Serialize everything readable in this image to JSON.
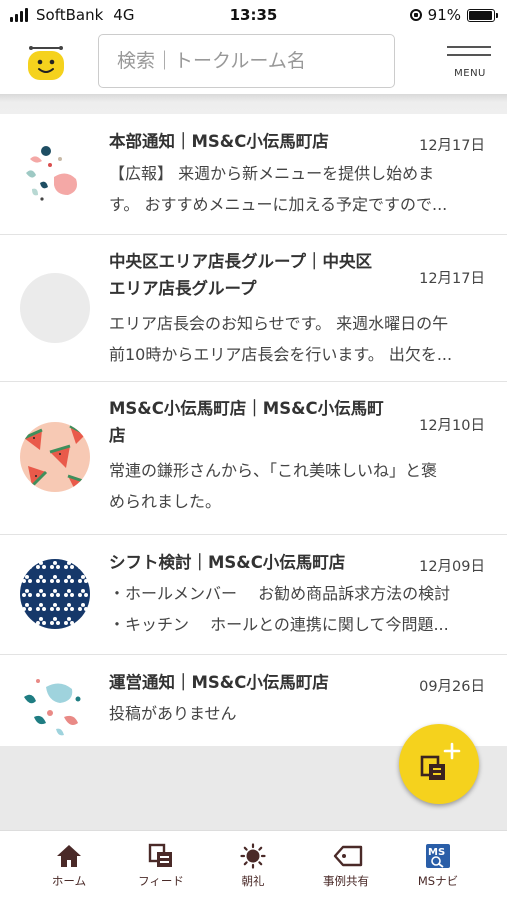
{
  "status_bar": {
    "carrier": "SoftBank",
    "network": "4G",
    "time": "13:35",
    "battery": "91%",
    "battery_level": 0.91
  },
  "header": {
    "search_placeholder": "検索｜トークルーム名",
    "menu_label": "MENU"
  },
  "rooms": [
    {
      "title": "本部通知｜MS&C小伝馬町店",
      "date": "12月17日",
      "preview_lines": [
        "【広報】 来週から新メニューを提供し始めま",
        "す。 おすすめメニューに加える予定ですので..."
      ],
      "avatar_icon": "confetti-pattern-icon"
    },
    {
      "title_lines": [
        "中央区エリア店長グループ｜中央区",
        "エリア店長グループ"
      ],
      "date": "12月17日",
      "preview_lines": [
        "エリア店長会のお知らせです。 来週水曜日の午",
        "前10時からエリア店長会を行います。 出欠を..."
      ],
      "avatar_icon": "blank-avatar-icon"
    },
    {
      "title_lines": [
        "MS&C小伝馬町店｜MS&C小伝馬町",
        "店"
      ],
      "date": "12月10日",
      "preview_lines": [
        "常連の鎌形さんから、「これ美味しいね」と褒",
        "められました。"
      ],
      "avatar_icon": "watermelon-pattern-icon"
    },
    {
      "title": "シフト検討｜MS&C小伝馬町店",
      "date": "12月09日",
      "preview_lines": [
        "・ホールメンバー　 お勧め商品訴求方法の検討",
        "・キッチン　 ホールとの連携に関して今問題..."
      ],
      "avatar_icon": "floral-pattern-icon"
    },
    {
      "title": "運営通知｜MS&C小伝馬町店",
      "date": "09月26日",
      "preview_lines": [
        "投稿がありません"
      ],
      "avatar_icon": "terrazzo-pattern-icon"
    }
  ],
  "tabs": [
    {
      "label": "ホーム",
      "icon": "home-icon"
    },
    {
      "label": "フィード",
      "icon": "feed-icon"
    },
    {
      "label": "朝礼",
      "icon": "sun-icon"
    },
    {
      "label": "事例共有",
      "icon": "tag-icon"
    },
    {
      "label": "MSナビ",
      "icon": "ms-navi-icon"
    }
  ],
  "colors": {
    "accent_yellow": "#f5d21d",
    "tab_icon_brown": "#4a2a28",
    "divider_grey": "#e9e9e9"
  }
}
